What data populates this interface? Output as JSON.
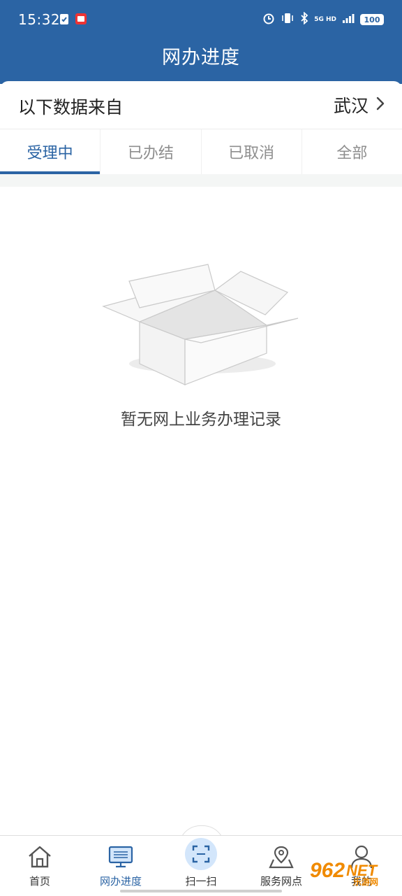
{
  "status_bar": {
    "time": "15:32",
    "network": "5G HD",
    "battery": "100",
    "icons": [
      "check-clipboard-icon",
      "app-notification-icon",
      "alarm-icon",
      "vibrate-icon",
      "bluetooth-icon",
      "signal-icon"
    ]
  },
  "header": {
    "title": "网办进度"
  },
  "source": {
    "label": "以下数据来自",
    "city": "武汉"
  },
  "tabs": [
    {
      "label": "受理中",
      "active": true
    },
    {
      "label": "已办结",
      "active": false
    },
    {
      "label": "已取消",
      "active": false
    },
    {
      "label": "全部",
      "active": false
    }
  ],
  "empty_state": {
    "message": "暂无网上业务办理记录",
    "icon": "empty-box-icon"
  },
  "bottom_nav": [
    {
      "label": "首页",
      "icon": "home-icon"
    },
    {
      "label": "网办进度",
      "icon": "monitor-icon",
      "active": true
    },
    {
      "label": "扫一扫",
      "icon": "scan-icon"
    },
    {
      "label": "服务网点",
      "icon": "map-pin-icon"
    },
    {
      "label": "我的",
      "icon": "user-icon"
    }
  ],
  "watermark": {
    "number": "962",
    "suffix": "NET",
    "sub": "乐游网"
  },
  "colors": {
    "brand": "#2b64a4",
    "scan_bg": "#d3e6fb",
    "watermark": "#f08a00"
  }
}
